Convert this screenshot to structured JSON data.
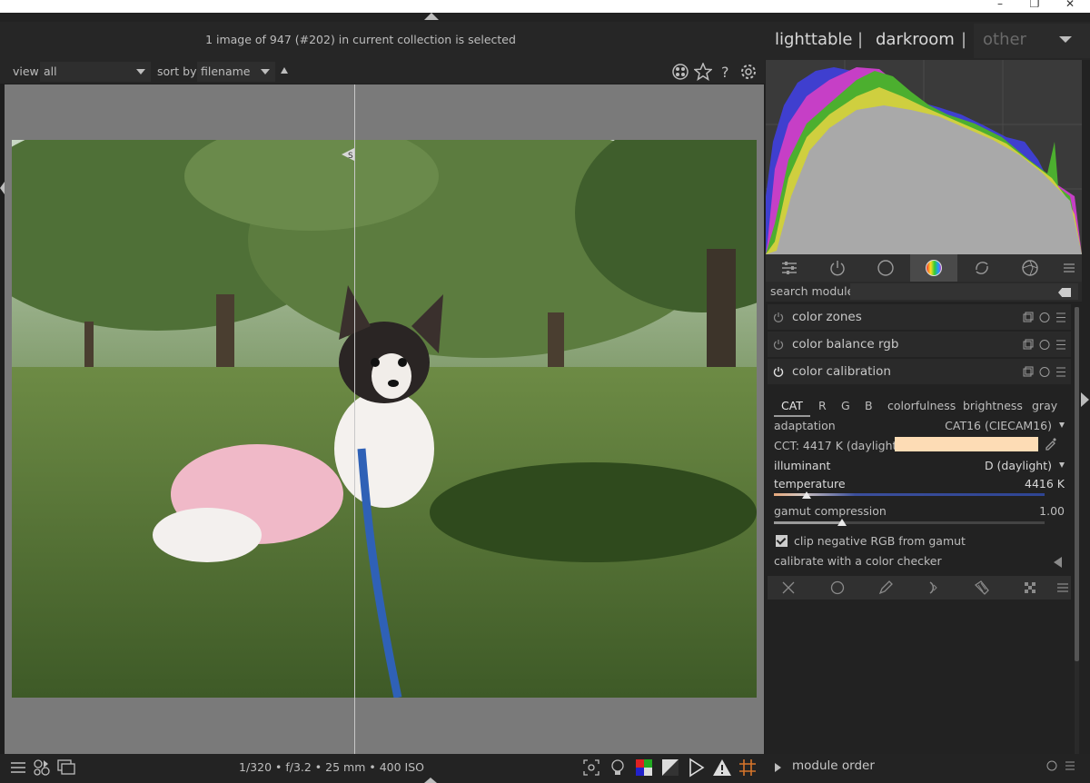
{
  "window": {
    "minimize": "–",
    "restore": "❐",
    "close": "✕"
  },
  "header": {
    "status": "1 image of 947 (#202) in current collection is selected"
  },
  "views": {
    "lighttable": "lighttable",
    "sep1": "|",
    "darkroom": "darkroom",
    "sep2": "|",
    "other": "other"
  },
  "filter": {
    "view_label": "view",
    "view_value": "all",
    "sort_label": "sort by",
    "sort_value": "filename"
  },
  "bottom": {
    "info": "1/320 • f/3.2 • 25 mm • 400 ISO"
  },
  "search": {
    "label": "search module"
  },
  "modules": [
    {
      "name": "color zones"
    },
    {
      "name": "color balance rgb"
    },
    {
      "name": "color calibration"
    }
  ],
  "calibration": {
    "tabs": [
      "CAT",
      "R",
      "G",
      "B",
      "colorfulness",
      "brightness",
      "gray"
    ],
    "adaptation_label": "adaptation",
    "adaptation_value": "CAT16 (CIECAM16)",
    "cct_text": "CCT: 4417 K (daylight)",
    "illuminant_label": "illuminant",
    "illuminant_value": "D (daylight)",
    "temperature_label": "temperature",
    "temperature_value": "4416 K",
    "temperature_fraction": 0.12,
    "gamut_label": "gamut compression",
    "gamut_value": "1.00",
    "gamut_fraction": 0.25,
    "clip_label": "clip negative RGB from gamut",
    "clip_checked": true,
    "checker_label": "calibrate with a color checker",
    "swatch_color": "#fddcb5"
  },
  "module_order": {
    "label": "module order"
  },
  "split_tag": "S"
}
